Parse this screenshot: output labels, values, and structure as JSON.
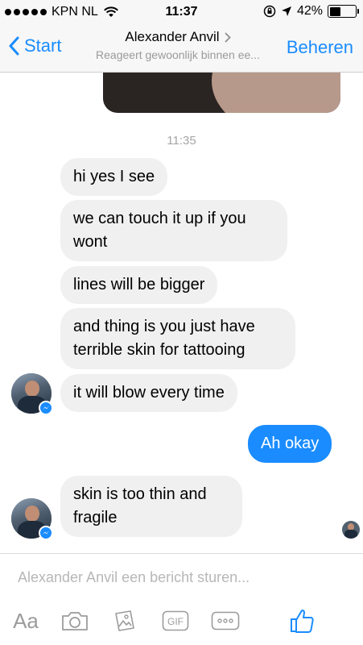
{
  "status_bar": {
    "carrier": "KPN NL",
    "time": "11:37",
    "battery": "42%",
    "battery_level": 0.42
  },
  "nav": {
    "back_label": "Start",
    "title": "Alexander Anvil",
    "subtitle": "Reageert gewoonlijk binnen ee...",
    "action_label": "Beheren"
  },
  "conversation": {
    "timestamp": "11:35",
    "messages": [
      {
        "direction": "in",
        "text": "hi yes I see"
      },
      {
        "direction": "in",
        "text": "we can touch it up if you wont"
      },
      {
        "direction": "in",
        "text": "lines will be bigger"
      },
      {
        "direction": "in",
        "text": "and thing is you just have terrible skin for tattooing"
      },
      {
        "direction": "in",
        "text": "it will blow every time"
      },
      {
        "direction": "out",
        "text": "Ah okay"
      },
      {
        "direction": "in",
        "text": "skin is too thin and fragile"
      }
    ]
  },
  "composer": {
    "placeholder": "Alexander Anvil een bericht sturen...",
    "text_button": "Aa",
    "gif_label": "GIF"
  },
  "colors": {
    "accent": "#1a8cff",
    "incoming_bubble": "#f0f0f0",
    "muted_text": "#a5a5a5",
    "icon_gray": "#9c9c9c"
  },
  "icons": [
    "wifi-icon",
    "lock-rotation-icon",
    "location-arrow-icon",
    "battery-icon",
    "chevron-left-icon",
    "chevron-right-icon",
    "messenger-badge-icon",
    "camera-icon",
    "gallery-icon",
    "gif-icon",
    "more-icon",
    "thumbs-up-icon"
  ]
}
